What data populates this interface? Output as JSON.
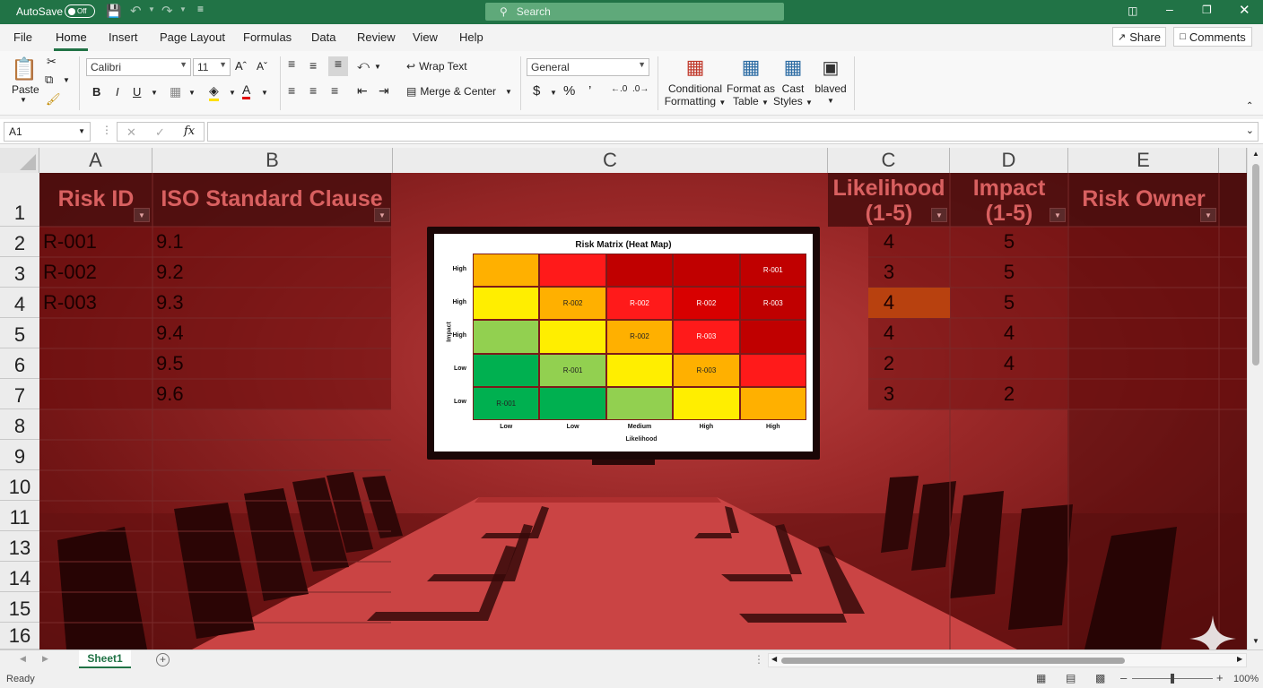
{
  "titlebar": {
    "autosave_label": "AutoSave",
    "autosave_state": "Off",
    "search_placeholder": "Search"
  },
  "menu": {
    "tabs": [
      "File",
      "Home",
      "Insert",
      "Page Layout",
      "Formulas",
      "Data",
      "Review",
      "View",
      "Help"
    ],
    "active": "Home",
    "share_label": "Share",
    "comments_label": "Comments"
  },
  "ribbon": {
    "paste_label": "Paste",
    "font_name": "Calibri",
    "font_size": "11",
    "wrap_text_label": "Wrap Text",
    "merge_center_label": "Merge & Center",
    "number_format": "General",
    "conditional_formatting_line1": "Conditional",
    "conditional_formatting_line2": "Formatting",
    "format_table_line1": "Format as",
    "format_table_line2": "Table",
    "cell_styles_line1": "Cast",
    "cell_styles_line2": "Styles",
    "extra_label": "blaved"
  },
  "formula_bar": {
    "name_box": "A1",
    "fx_label": "fx",
    "content": ""
  },
  "columns": [
    "A",
    "B",
    "C",
    "C",
    "D",
    "E"
  ],
  "rows": [
    "1",
    "2",
    "3",
    "4",
    "5",
    "6",
    "7",
    "8",
    "9",
    "10",
    "11",
    "13",
    "14",
    "15",
    "16"
  ],
  "headers": {
    "risk_id": "Risk ID",
    "iso_clause": "ISO Standard Clause",
    "likelihood_line1": "Likelihood",
    "likelihood_line2": "(1-5)",
    "impact_line1": "Impact",
    "impact_line2": "(1-5)",
    "risk_owner": "Risk Owner"
  },
  "table_rows": [
    {
      "risk_id": "R-001",
      "clause": "9.1",
      "likelihood": "4",
      "impact": "5"
    },
    {
      "risk_id": "R-002",
      "clause": "9.2",
      "likelihood": "3",
      "impact": "5"
    },
    {
      "risk_id": "R-003",
      "clause": "9.3",
      "likelihood": "4",
      "impact": "5"
    },
    {
      "risk_id": "",
      "clause": "9.4",
      "likelihood": "4",
      "impact": "4"
    },
    {
      "risk_id": "",
      "clause": "9.5",
      "likelihood": "2",
      "impact": "4"
    },
    {
      "risk_id": "",
      "clause": "9.6",
      "likelihood": "3",
      "impact": "2"
    }
  ],
  "heatmap": {
    "title": "Risk Matrix (Heat Map)",
    "y_axis_label": "Impact",
    "x_axis_label": "Likelihood",
    "y_ticks": [
      "High",
      "High",
      "High",
      "Low",
      "Low"
    ],
    "x_ticks": [
      "Low",
      "Low",
      "Medium",
      "High",
      "High"
    ],
    "cells": [
      [
        {
          "color": "#ffb000",
          "label": ""
        },
        {
          "color": "#ff1a1a",
          "label": ""
        },
        {
          "color": "#c00000",
          "label": ""
        },
        {
          "color": "#c00000",
          "label": ""
        },
        {
          "color": "#c00000",
          "label": "R-001"
        }
      ],
      [
        {
          "color": "#ffee00",
          "label": ""
        },
        {
          "color": "#ffb000",
          "label": "R-002"
        },
        {
          "color": "#ff1a1a",
          "label": "R-002"
        },
        {
          "color": "#d80000",
          "label": "R-002"
        },
        {
          "color": "#c00000",
          "label": "R-003"
        }
      ],
      [
        {
          "color": "#92d050",
          "label": ""
        },
        {
          "color": "#ffee00",
          "label": ""
        },
        {
          "color": "#ffb000",
          "label": "R-002"
        },
        {
          "color": "#ff1a1a",
          "label": "R-003"
        },
        {
          "color": "#c00000",
          "label": ""
        }
      ],
      [
        {
          "color": "#00b050",
          "label": ""
        },
        {
          "color": "#92d050",
          "label": "R-001"
        },
        {
          "color": "#ffee00",
          "label": ""
        },
        {
          "color": "#ffb000",
          "label": "R-003"
        },
        {
          "color": "#ff1a1a",
          "label": ""
        }
      ],
      [
        {
          "color": "#00b050",
          "label": "R-001"
        },
        {
          "color": "#00b050",
          "label": ""
        },
        {
          "color": "#92d050",
          "label": ""
        },
        {
          "color": "#ffee00",
          "label": ""
        },
        {
          "color": "#ffb000",
          "label": ""
        }
      ]
    ]
  },
  "sheet_tabs": [
    "Sheet1"
  ],
  "status": {
    "ready": "Ready",
    "zoom": "100%"
  },
  "colors": {
    "excel_green": "#217346",
    "room_red": "#8e1e1e"
  }
}
